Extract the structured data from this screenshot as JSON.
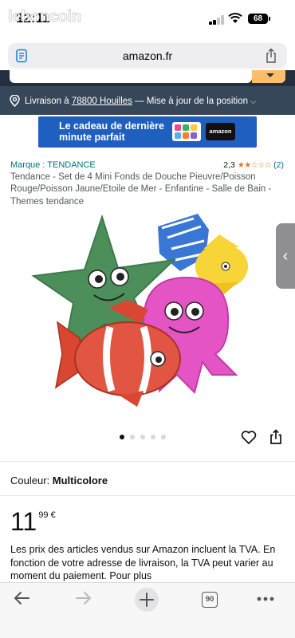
{
  "status_bar": {
    "time": "12:11",
    "watermark": "leboncoin",
    "battery": "68"
  },
  "browser": {
    "url": "amazon.fr",
    "tab_count": "90"
  },
  "location": {
    "prefix": "Livraison à",
    "postcode": "78800 Houilles",
    "suffix": "— Mise à jour de la position"
  },
  "banner": {
    "line1": "Le cadeau de dernière",
    "line2": "minute parfait",
    "gift_card_label": "amazon"
  },
  "product": {
    "brand": "Marque : TENDANCE",
    "rating_value": "2,3",
    "rating_stars": 2.3,
    "rating_count": "(2)",
    "title": "Tendance - Set de 4 Mini Fonds de Douche Pieuvre/Poisson Rouge/Poisson Jaune/Etoile de Mer - Enfantine - Salle de Bain - Themes tendance",
    "gallery_position": "1 / 5",
    "color_label": "Couleur:",
    "color_value": "Multicolore",
    "price_whole": "11",
    "price_fraction": "99 €",
    "tax_note": "Les prix des articles vendus sur Amazon incluent la TVA. En fonction de votre adresse de livraison, la TVA peut varier au moment du paiement. Pour plus"
  },
  "colors": {
    "amazon_dark": "#232f3e",
    "location_bar": "#37475a",
    "link": "#007185",
    "star": "#de7921",
    "banner": "#1f5fc0"
  },
  "icons": {
    "reader": "reader-icon",
    "share": "share-icon",
    "pin": "location-pin-icon",
    "heart": "heart-icon",
    "back": "back-arrow-icon",
    "forward": "forward-arrow-icon",
    "new_tab": "plus-icon",
    "tabs": "tabs-icon",
    "more": "more-icon"
  }
}
